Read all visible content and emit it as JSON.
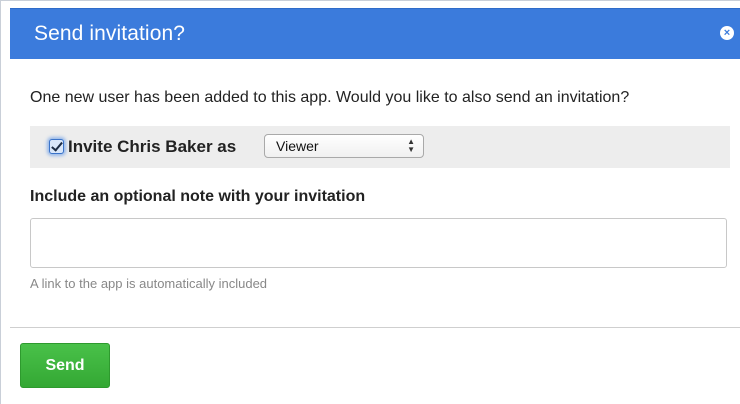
{
  "dialog": {
    "title": "Send invitation?",
    "close_icon": "×",
    "message": "One new user has been added to this app. Would you like to also send an invitation?",
    "invite": {
      "checked": true,
      "label": "Invite Chris Baker as",
      "role_selected": "Viewer",
      "role_arrows": "▲▼"
    },
    "note": {
      "heading": "Include an optional note with your invitation",
      "value": "",
      "hint": "A link to the app is automatically included"
    },
    "send_label": "Send"
  },
  "colors": {
    "titlebar": "#3b7bdc",
    "send_button": "#3cb43c",
    "invite_row_bg": "#ededed"
  }
}
